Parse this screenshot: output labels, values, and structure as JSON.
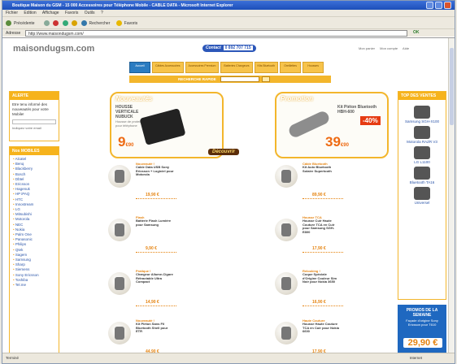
{
  "window": {
    "title": "Boutique Maison du GSM - 15 000 Accessoires pour Téléphone Mobile - CABLE DATA - Microsoft Internet Explorer"
  },
  "menu": [
    "Fichier",
    "Edition",
    "Affichage",
    "Favoris",
    "Outils",
    "?"
  ],
  "toolbar": {
    "back": "Précédente",
    "search": "Rechercher",
    "favorites": "Favoris"
  },
  "address": {
    "label": "Adresse",
    "url": "http://www.maisondugsm.com/",
    "go": "OK"
  },
  "header": {
    "logo_mark": "",
    "logo_text": "maisondugsm.com",
    "phone_label": "Contact",
    "phone": "0 892 707 715",
    "links": [
      "Mon panier",
      "Mon compte",
      "Aide"
    ]
  },
  "nav": {
    "tabs": [
      "Accueil",
      "Câbles Accessoires",
      "Accessoires Premium",
      "Batteries Chargeurs",
      "Kits Bluetooth",
      "Oreillettes",
      "Housses"
    ],
    "active": 0
  },
  "search": {
    "label": "RECHERCHE RAPIDE",
    "button": "OK"
  },
  "alerte": {
    "title": "ALERTE",
    "text": "Etre tenu informé des nouveautés pour votre Mobile!",
    "note": "Indiquez votre email"
  },
  "brands": {
    "title": "Nos MOBILES",
    "items": [
      "Alcatel",
      "Benq",
      "Blackberry",
      "Bosch",
      "Dbtel",
      "Ericsson",
      "Hagenuk",
      "HP iPAQ",
      "HTC",
      "Innostream",
      "LG",
      "Mitsubishi",
      "Motorola",
      "NEC",
      "Nokia",
      "Palm One",
      "Panasonic",
      "Philips",
      "Qtek",
      "Sagem",
      "Samsung",
      "Sharp",
      "Siemens",
      "Sony Ericsson",
      "Toshiba",
      "Tel.me"
    ]
  },
  "promo_left": {
    "title": "Nouveautés",
    "name": "HOUSSE VERTICALE NUBUCK",
    "desc": "Housse de protection verticale pour téléphone",
    "price": "9",
    "cents": "€90"
  },
  "promo_right": {
    "title": "Promotion",
    "name": "Kit Piéton Bluetooth HBH-600",
    "badge": "-40%",
    "price": "39",
    "cents": "€90"
  },
  "discover": "Découvrir",
  "products": [
    {
      "tag": "Nouveauté !",
      "desc": "Cable Data USB Sony Ericsson + Logiciel pour Motorola",
      "price": "19,90 €"
    },
    {
      "tag": "Câble Bluetooth",
      "desc": "Kit Auto Bluetooth Solaire Supertooth",
      "price": "89,90 €"
    },
    {
      "tag": "Flash",
      "desc": "Batterie Flash Lumière pour Samsung",
      "price": "9,90 €"
    },
    {
      "tag": "Housse TCA",
      "desc": "Housse Cuir Haute Couture TCA en Cuir pour Samsung SGH-E800",
      "price": "17,90 €"
    },
    {
      "tag": "Pratique !",
      "desc": "Chargeur Allume-Cigare Rétractable Ultra Compact",
      "price": "14,90 €"
    },
    {
      "tag": "Relooking !",
      "desc": "Coque Spéciale d'Origine Couleur Sim Noir pour Nokia 3650",
      "price": "16,90 €"
    },
    {
      "tag": "Nouveauté !",
      "desc": "Kit Piéton Sans Fil Bluetooth Shell pour ETR",
      "price": "44,90 €"
    },
    {
      "tag": "Haute Couture",
      "desc": "Housse Haute Couture TCA en Cuir pour Nokia 6600",
      "price": "17,90 €"
    }
  ],
  "top_ventes": {
    "title": "TOP DES VENTES",
    "items": [
      "Samsung SGH-X100",
      "Motorola RAZR V3",
      "LG L1100",
      "Bluetooth TA16",
      "Universel"
    ]
  },
  "promo_side": {
    "title": "PROMOS DE LA SEMAINE",
    "desc": "Façade d'origine Sony Ericsson pour T610",
    "price": "29,90 €"
  },
  "status": {
    "text": "Terminé",
    "zone": "Internet"
  }
}
